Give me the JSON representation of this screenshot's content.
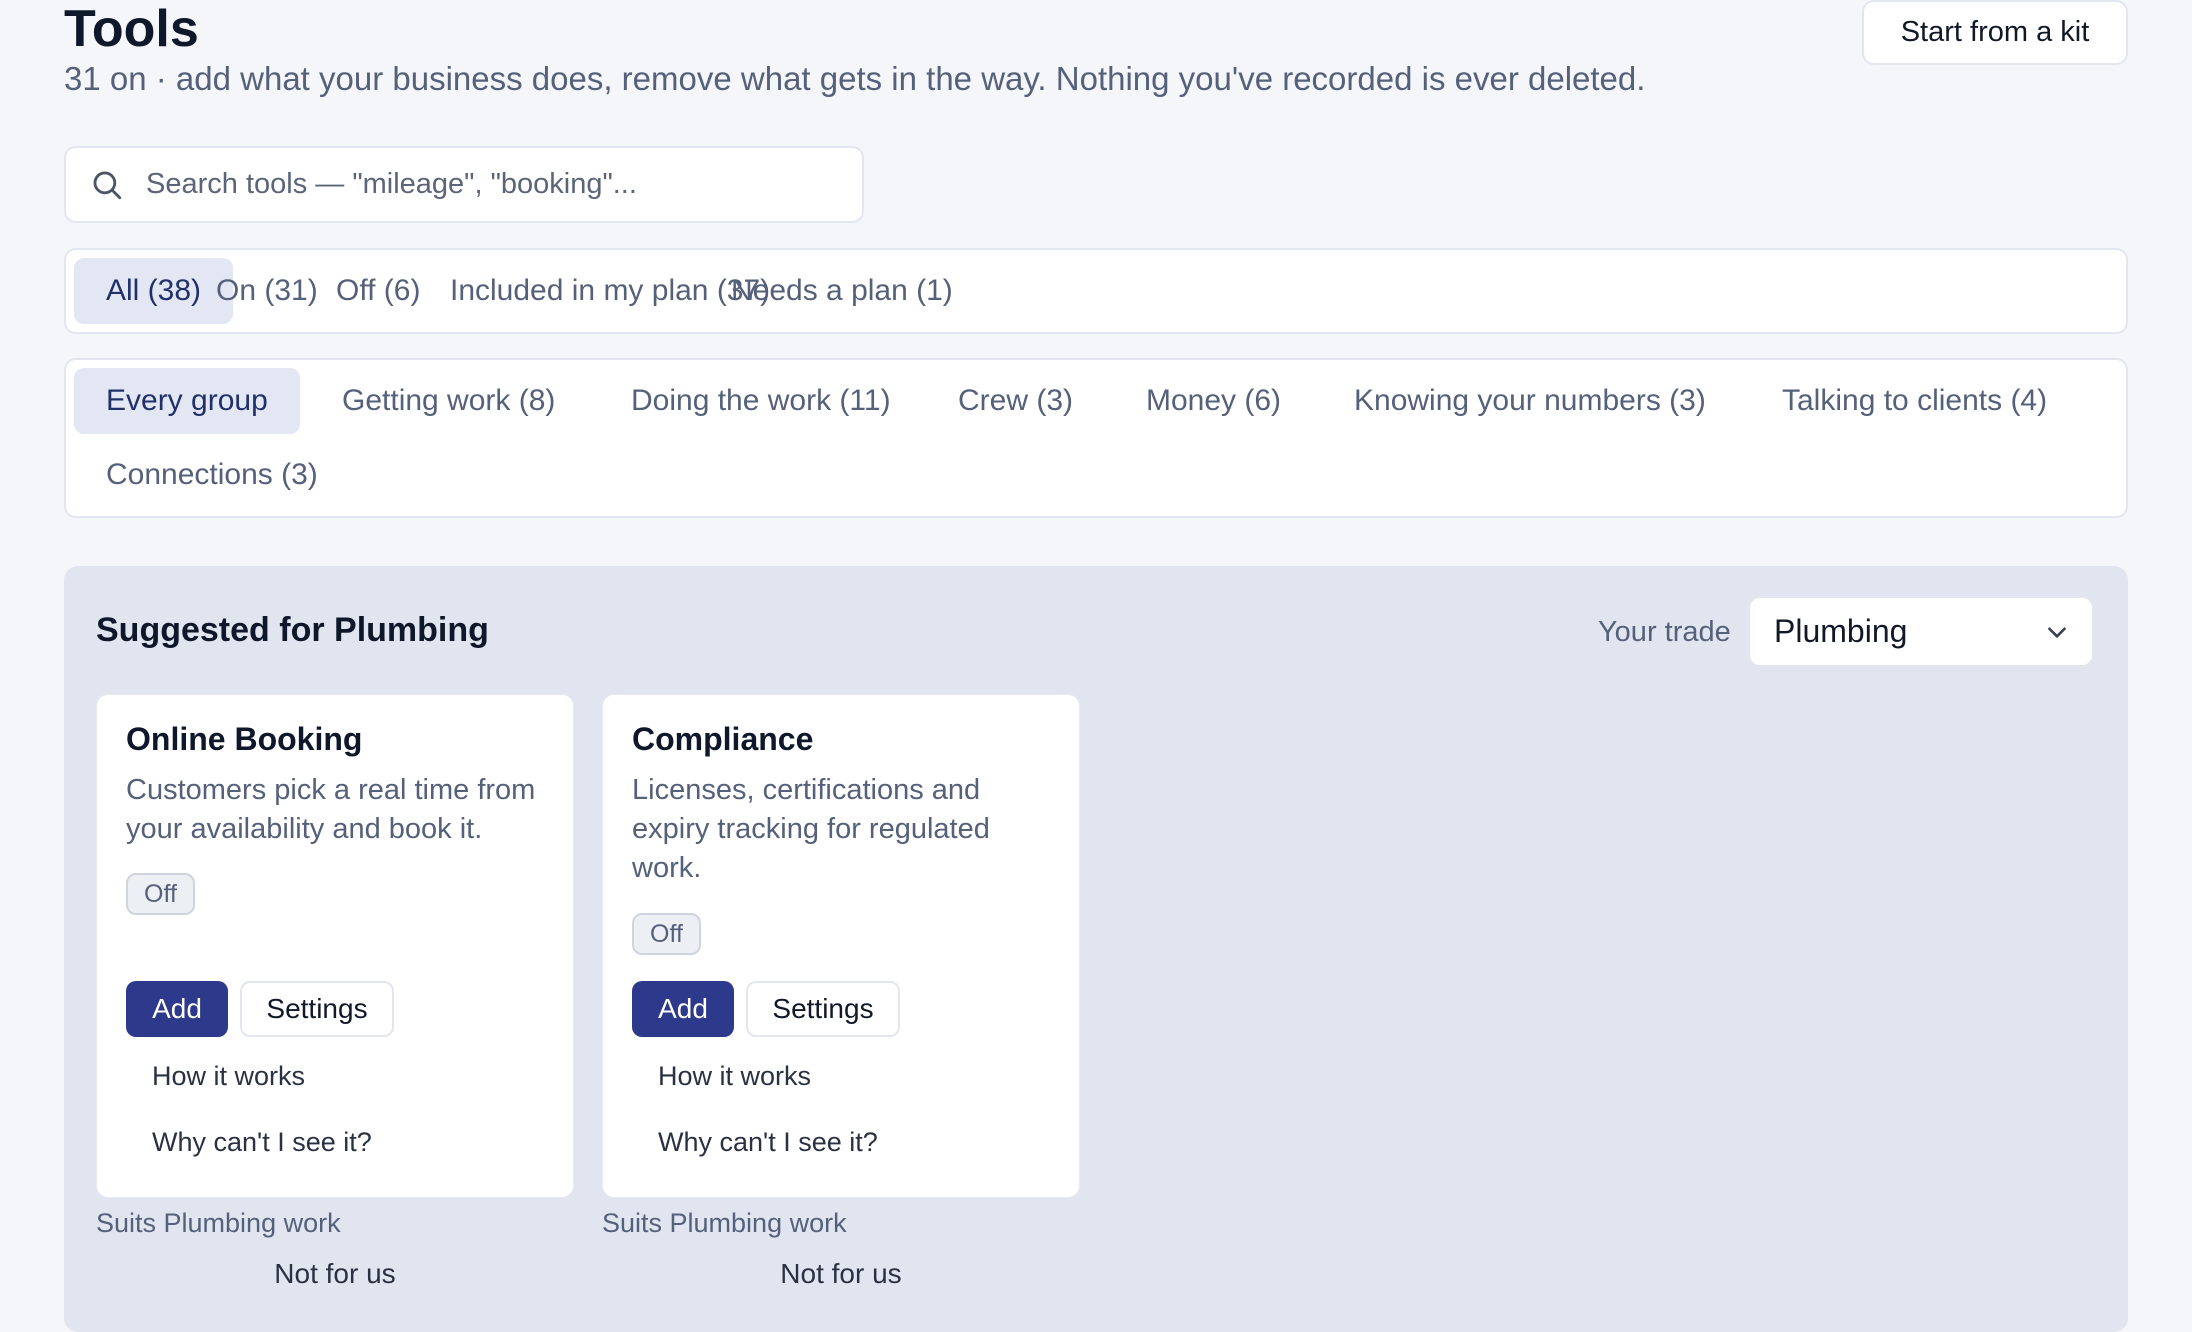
{
  "header": {
    "title": "Tools",
    "subtitle": "31 on · add what your business does, remove what gets in the way. Nothing you've recorded is ever deleted.",
    "kit_button": "Start from a kit"
  },
  "search": {
    "placeholder": "Search tools — \"mileage\", \"booking\"..."
  },
  "filters": {
    "tabs": [
      {
        "label": "All (38)",
        "active": true
      },
      {
        "label": "On (31)"
      },
      {
        "label": "Off (6)"
      },
      {
        "label": "Included in my plan (37)"
      },
      {
        "label": "Needs a plan (1)"
      }
    ]
  },
  "groups": {
    "tabs": [
      {
        "label": "Every group",
        "active": true
      },
      {
        "label": "Getting work (8)"
      },
      {
        "label": "Doing the work (11)"
      },
      {
        "label": "Crew (3)"
      },
      {
        "label": "Money (6)"
      },
      {
        "label": "Knowing your numbers (3)"
      },
      {
        "label": "Talking to clients (4)"
      },
      {
        "label": "Connections (3)"
      }
    ]
  },
  "suggested": {
    "title": "Suggested for Plumbing",
    "trade_label": "Your trade",
    "trade_value": "Plumbing",
    "cards": [
      {
        "title": "Online Booking",
        "description": "Customers pick a real time from your availability and book it.",
        "status": "Off",
        "add_label": "Add",
        "settings_label": "Settings",
        "how_label": "How it works",
        "why_label": "Why can't I see it?",
        "suits": "Suits Plumbing work",
        "not_for_us": "Not for us"
      },
      {
        "title": "Compliance",
        "description": "Licenses, certifications and expiry tracking for regulated work.",
        "status": "Off",
        "add_label": "Add",
        "settings_label": "Settings",
        "how_label": "How it works",
        "why_label": "Why can't I see it?",
        "suits": "Suits Plumbing work",
        "not_for_us": "Not for us"
      }
    ]
  },
  "colors": {
    "accent": "#2d3a8c",
    "background": "#f5f6fa",
    "panel": "#e1e5f0"
  },
  "icons": {
    "search": "search-icon",
    "dropdown": "chevron-down-icon"
  }
}
